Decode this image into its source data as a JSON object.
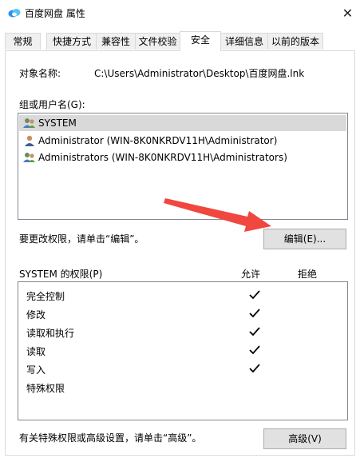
{
  "window": {
    "title": "百度网盘 属性",
    "close_glyph": "✕"
  },
  "tabs": [
    {
      "label": "常规"
    },
    {
      "label": "快捷方式"
    },
    {
      "label": "兼容性"
    },
    {
      "label": "文件校验"
    },
    {
      "label": "安全",
      "active": true
    },
    {
      "label": "详细信息"
    },
    {
      "label": "以前的版本"
    }
  ],
  "security": {
    "object_name_label": "对象名称:",
    "object_name_value": "C:\\Users\\Administrator\\Desktop\\百度网盘.lnk",
    "groups_label": "组或用户名(G):",
    "users": [
      {
        "name": "SYSTEM",
        "selected": true
      },
      {
        "name": "Administrator (WIN-8K0NKRDV11H\\Administrator)"
      },
      {
        "name": "Administrators (WIN-8K0NKRDV11H\\Administrators)"
      }
    ],
    "edit_hint": "要更改权限，请单击“编辑”。",
    "edit_button": "编辑(E)...",
    "perms_label": "SYSTEM 的权限(P)",
    "allow_header": "允许",
    "deny_header": "拒绝",
    "permissions": [
      {
        "name": "完全控制",
        "allow": true,
        "deny": false
      },
      {
        "name": "修改",
        "allow": true,
        "deny": false
      },
      {
        "name": "读取和执行",
        "allow": true,
        "deny": false
      },
      {
        "name": "读取",
        "allow": true,
        "deny": false
      },
      {
        "name": "写入",
        "allow": true,
        "deny": false
      },
      {
        "name": "特殊权限",
        "allow": false,
        "deny": false
      }
    ],
    "advanced_hint": "有关特殊权限或高级设置，请单击“高级”。",
    "advanced_button": "高级(V)"
  },
  "colors": {
    "annotation_arrow": "#f0473f",
    "selected_row": "#d9d9d9"
  }
}
